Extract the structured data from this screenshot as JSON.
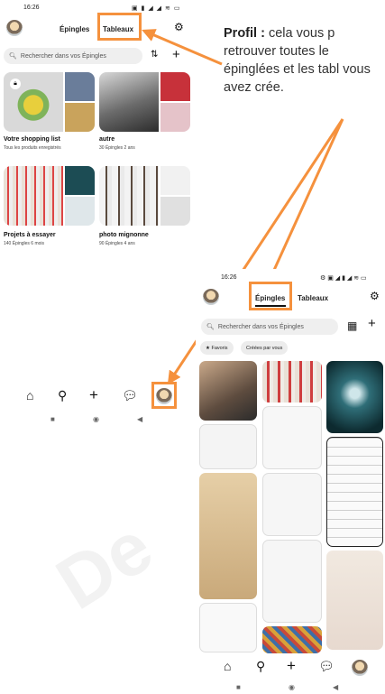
{
  "annotation": {
    "bold": "Profil :",
    "text": " cela vous p retrouver toutes le épinglées et les tabl vous avez crée."
  },
  "watermark": "De",
  "left_screen": {
    "status": {
      "time": "16:26",
      "icons": "▣ ▮ ◢ ◢ ≋ ▭"
    },
    "tabs": [
      "Épingles",
      "Tableaux"
    ],
    "active_tab": "Tableaux",
    "search_placeholder": "Rechercher dans vos Épingles",
    "boards": [
      {
        "name": "Votre shopping list",
        "meta": "Tous les produits enregistrés"
      },
      {
        "name": "autre",
        "meta": "30 Épingles  2 ans"
      },
      {
        "name": "Projets à essayer",
        "meta": "140 Épingles  6 mois"
      },
      {
        "name": "photo mignonne",
        "meta": "90 Épingles  4 ans"
      }
    ],
    "nav_icons": [
      "home-icon",
      "search-icon",
      "plus-icon",
      "chat-icon",
      "profile-avatar"
    ],
    "system_bar": [
      "■",
      "◉",
      "◀"
    ]
  },
  "right_screen": {
    "status": {
      "time": "16:26",
      "icons": "⚙ ▣ ◢ ▮ ◢ ≋ ▭"
    },
    "tabs": [
      "Épingles",
      "Tableaux"
    ],
    "active_tab": "Épingles",
    "search_placeholder": "Rechercher dans vos Épingles",
    "chips": [
      "★ Favoris",
      "Créées par vous"
    ],
    "nav_icons": [
      "home-icon",
      "search-icon",
      "plus-icon",
      "chat-icon",
      "profile-avatar"
    ],
    "system_bar": [
      "■",
      "◉",
      "◀"
    ]
  },
  "colors": {
    "highlight": "#f5913d",
    "chip_bg": "#ececec",
    "search_bg": "#efefef"
  }
}
